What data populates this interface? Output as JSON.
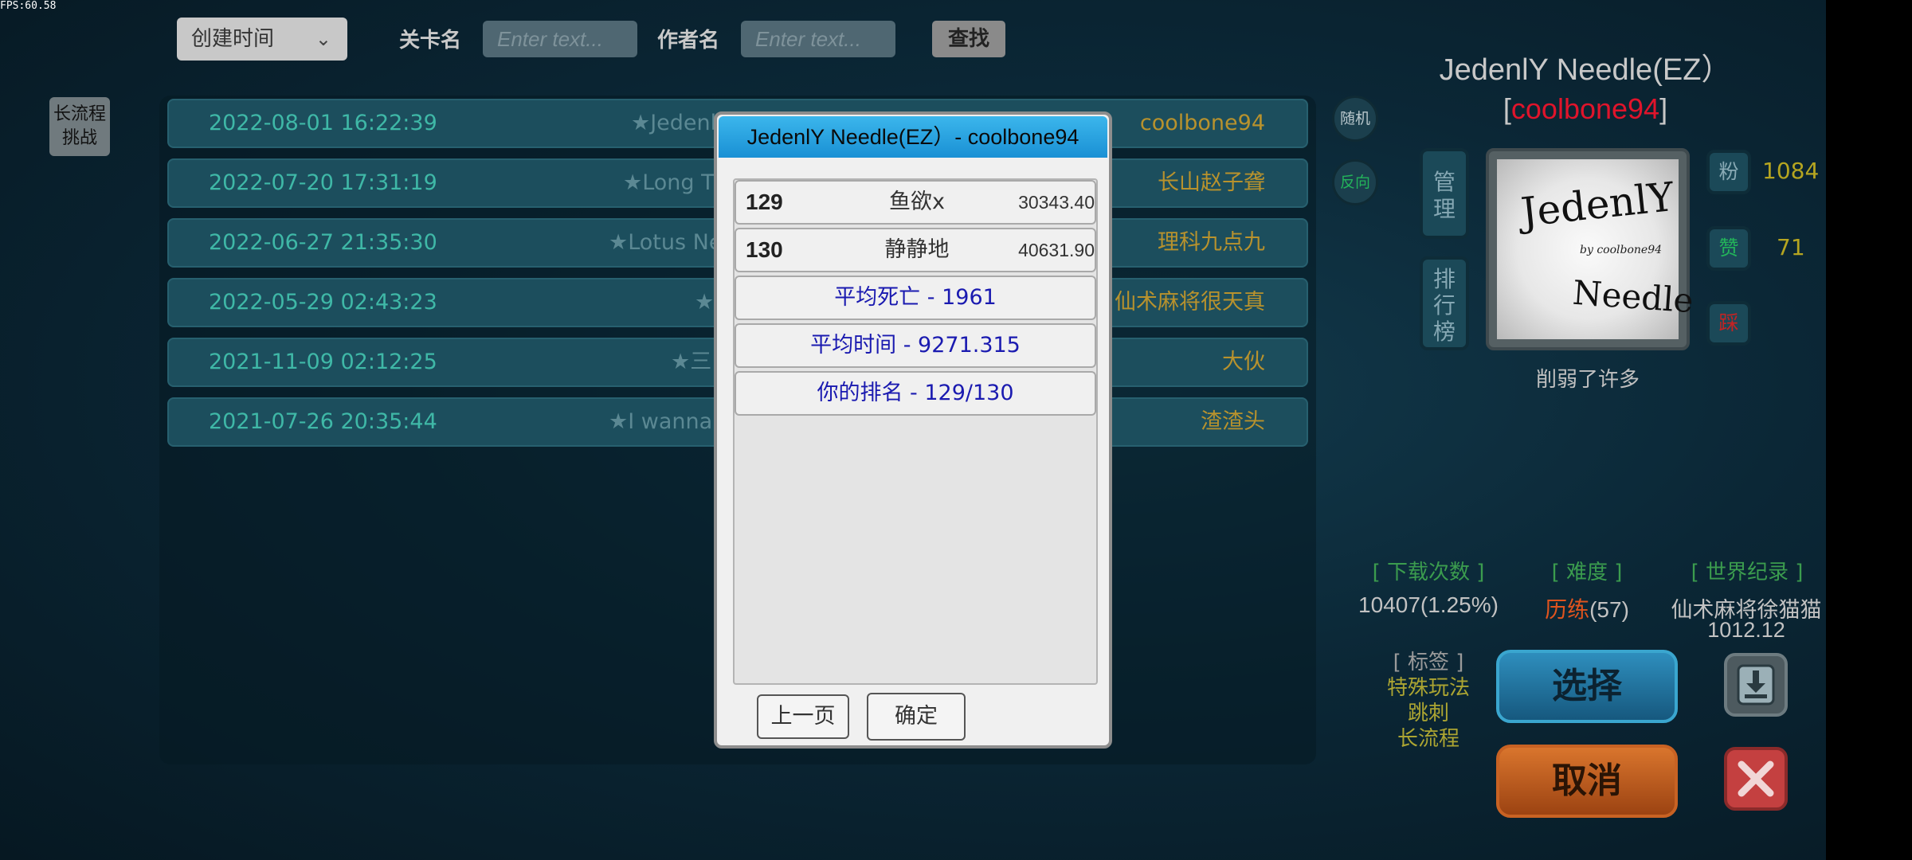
{
  "fps": "FPS:60.58",
  "filter": {
    "sort_value": "创建时间",
    "level_label": "关卡名",
    "level_placeholder": "Enter text...",
    "author_label": "作者名",
    "author_placeholder": "Enter text...",
    "find_label": "查找"
  },
  "side_button": {
    "line1": "长流程",
    "line2": "挑战"
  },
  "rows": [
    {
      "date": "2022-08-01 16:22:39",
      "name": "★Jedenl",
      "author": "coolbone94"
    },
    {
      "date": "2022-07-20 17:31:19",
      "name": "★Long T",
      "author": "长山赵子聋"
    },
    {
      "date": "2022-06-27 21:35:30",
      "name": "★Lotus Ne",
      "author": "理科九点九"
    },
    {
      "date": "2022-05-29 02:43:23",
      "name": "★",
      "author": "仙术麻将很天真"
    },
    {
      "date": "2021-11-09 02:12:25",
      "name": "★三",
      "author": "大伙"
    },
    {
      "date": "2021-07-26 20:35:44",
      "name": "★I wanna l",
      "author": "渣渣头"
    }
  ],
  "toggles": {
    "random": "随机",
    "reverse": "反向"
  },
  "level": {
    "title": "JedenlY Needle(EZ）",
    "author_open": "[",
    "author": "coolbone94",
    "author_close": "]",
    "manage_label": "管理",
    "leaderboard_label": "排行榜",
    "thumb_line1": "JedenlY",
    "thumb_by": "by coolbone94",
    "thumb_line2": "Needle",
    "fans_icon": "粉",
    "fans_count": "1084",
    "likes_icon": "赞",
    "likes_count": "71",
    "delete_icon": "踩",
    "description": "削弱了许多",
    "downloads_header": "[ 下载次数 ]",
    "downloads_value": "10407(1.25%)",
    "difficulty_header": "[ 难度 ]",
    "difficulty_name": "历练",
    "difficulty_num": "(57)",
    "record_header": "[ 世界纪录 ]",
    "record_holder": "仙术麻将徐猫猫",
    "record_time": "1012.12",
    "tags_header": "[ 标签 ]",
    "tags": [
      "特殊玩法",
      "跳刺",
      "长流程"
    ],
    "select_label": "选择",
    "cancel_label": "取消"
  },
  "modal": {
    "title": "JedenlY Needle(EZ）- coolbone94",
    "entries": [
      {
        "rank": "129",
        "player": "鱼欲x",
        "score": "30343.40"
      },
      {
        "rank": "130",
        "player": "静静地",
        "score": "40631.90"
      }
    ],
    "avg_death": "平均死亡 - 1961",
    "avg_time": "平均时间 - 9271.315",
    "my_rank": "你的排名 - 129/130",
    "prev_label": "上一页",
    "ok_label": "确定"
  },
  "colors": {
    "accent_blue": "#1a90d4",
    "author_red": "#e0142b",
    "date_teal": "#3fb8a7",
    "author_gold": "#b8922d"
  }
}
